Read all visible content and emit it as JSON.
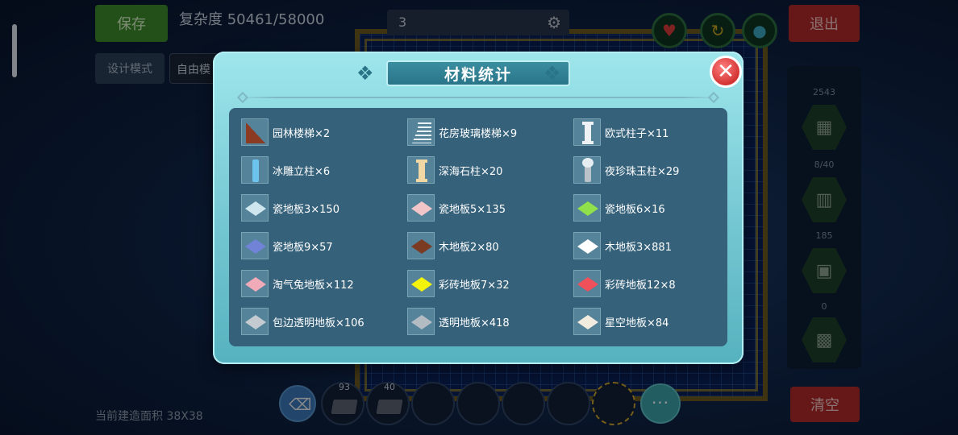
{
  "hud": {
    "save_label": "保存",
    "complexity_label": "复杂度 50461/58000",
    "search_value": "3",
    "exit_label": "退出",
    "design_mode_label": "设计模式",
    "free_mode_label": "自由模",
    "clear_label": "清空",
    "build_area_label": "当前建造面积 38X38",
    "right_panel_counts": [
      "2543",
      "8/40",
      "185",
      "0"
    ],
    "hotbar_counts": [
      "93",
      "40"
    ],
    "more_label": "···"
  },
  "modal": {
    "title": "材料统计",
    "close_symbol": "✕",
    "items": [
      {
        "label": "园林楼梯×2",
        "icon": "garden-stairs-icon",
        "kind": "stairs",
        "color": "#8a3b22"
      },
      {
        "label": "花房玻璃楼梯×9",
        "icon": "glass-stairs-icon",
        "kind": "stairs-lines",
        "color": "#e8f2f6"
      },
      {
        "label": "欧式柱子×11",
        "icon": "european-pillar-icon",
        "kind": "pillar-cap",
        "color": "#eef2f4"
      },
      {
        "label": "冰雕立柱×6",
        "icon": "ice-pillar-icon",
        "kind": "pillar",
        "color": "#6cc4ee"
      },
      {
        "label": "深海石柱×20",
        "icon": "deep-sea-pillar-icon",
        "kind": "pillar-cap",
        "color": "#f0d7a4"
      },
      {
        "label": "夜珍珠玉柱×29",
        "icon": "pearl-pillar-icon",
        "kind": "pillar-orb",
        "color": "#b9c3c9"
      },
      {
        "label": "瓷地板3×150",
        "icon": "tile-floor-icon",
        "kind": "diamond",
        "color": "#cfe6ef"
      },
      {
        "label": "瓷地板5×135",
        "icon": "tile-floor-icon",
        "kind": "diamond",
        "color": "#f2c6c8"
      },
      {
        "label": "瓷地板6×16",
        "icon": "tile-floor-icon",
        "kind": "diamond",
        "color": "#8fe04a"
      },
      {
        "label": "瓷地板9×57",
        "icon": "tile-floor-icon",
        "kind": "diamond",
        "color": "#7083d6"
      },
      {
        "label": "木地板2×80",
        "icon": "wood-floor-icon",
        "kind": "diamond",
        "color": "#7b3a22"
      },
      {
        "label": "木地板3×881",
        "icon": "wood-floor-icon",
        "kind": "diamond",
        "color": "#ffffff"
      },
      {
        "label": "淘气兔地板×112",
        "icon": "bunny-floor-icon",
        "kind": "diamond",
        "color": "#f0aab8"
      },
      {
        "label": "彩砖地板7×32",
        "icon": "color-brick-floor-icon",
        "kind": "diamond",
        "color": "#f2f20a"
      },
      {
        "label": "彩砖地板12×8",
        "icon": "color-brick-floor-icon",
        "kind": "diamond",
        "color": "#f0505a"
      },
      {
        "label": "包边透明地板×106",
        "icon": "trimmed-clear-floor-icon",
        "kind": "diamond",
        "color": "#c3cbd1"
      },
      {
        "label": "透明地板×418",
        "icon": "clear-floor-icon",
        "kind": "diamond",
        "color": "#b4bcc3"
      },
      {
        "label": "星空地板×84",
        "icon": "starry-floor-icon",
        "kind": "diamond",
        "color": "#f2ece0"
      }
    ]
  }
}
